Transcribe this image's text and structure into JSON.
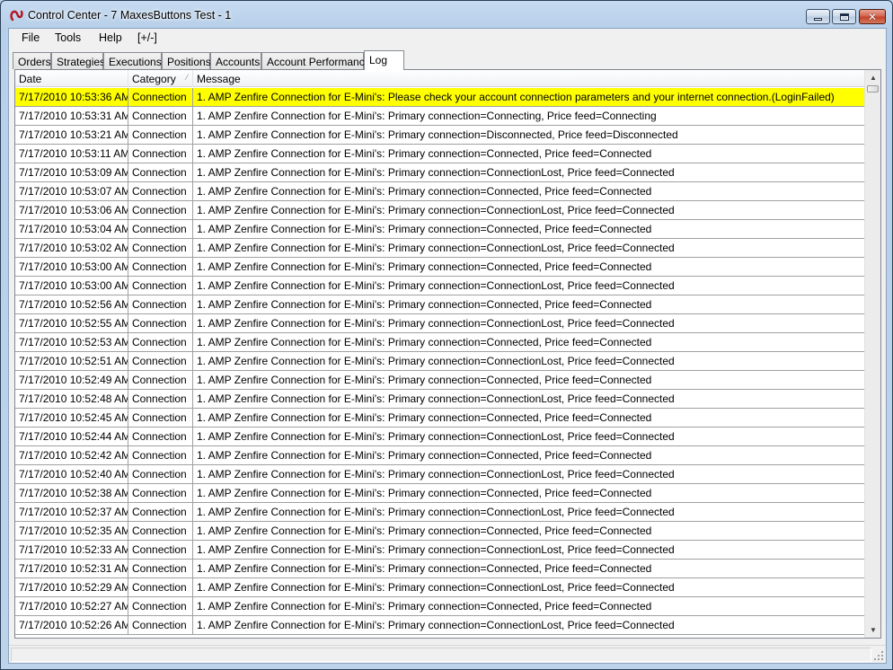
{
  "window": {
    "title": "Control Center - 7 MaxesButtons Test - 1",
    "app_icon": "ninja-logo-icon"
  },
  "menu": {
    "items": [
      {
        "label": "File"
      },
      {
        "label": "Tools"
      },
      {
        "label": "Help"
      },
      {
        "label": "[+/-]"
      }
    ]
  },
  "tabs": [
    {
      "label": "Orders"
    },
    {
      "label": "Strategies"
    },
    {
      "label": "Executions"
    },
    {
      "label": "Positions"
    },
    {
      "label": "Accounts"
    },
    {
      "label": "Account Performance"
    },
    {
      "label": "Log",
      "active": true
    }
  ],
  "log": {
    "columns": {
      "date": "Date",
      "category": "Category",
      "message": "Message"
    },
    "highlight_color": "#ffff00",
    "rows": [
      {
        "date": "7/17/2010 10:53:36 AM",
        "category": "Connection",
        "message": "1. AMP Zenfire Connection for E-Mini's: Please check your account connection parameters and your internet connection.(LoginFailed)",
        "highlight": true
      },
      {
        "date": "7/17/2010 10:53:31 AM",
        "category": "Connection",
        "message": "1. AMP Zenfire Connection for E-Mini's: Primary connection=Connecting, Price feed=Connecting"
      },
      {
        "date": "7/17/2010 10:53:21 AM",
        "category": "Connection",
        "message": "1. AMP Zenfire Connection for E-Mini's: Primary connection=Disconnected, Price feed=Disconnected"
      },
      {
        "date": "7/17/2010 10:53:11 AM",
        "category": "Connection",
        "message": "1. AMP Zenfire Connection for E-Mini's: Primary connection=Connected, Price feed=Connected"
      },
      {
        "date": "7/17/2010 10:53:09 AM",
        "category": "Connection",
        "message": "1. AMP Zenfire Connection for E-Mini's: Primary connection=ConnectionLost, Price feed=Connected"
      },
      {
        "date": "7/17/2010 10:53:07 AM",
        "category": "Connection",
        "message": "1. AMP Zenfire Connection for E-Mini's: Primary connection=Connected, Price feed=Connected"
      },
      {
        "date": "7/17/2010 10:53:06 AM",
        "category": "Connection",
        "message": "1. AMP Zenfire Connection for E-Mini's: Primary connection=ConnectionLost, Price feed=Connected"
      },
      {
        "date": "7/17/2010 10:53:04 AM",
        "category": "Connection",
        "message": "1. AMP Zenfire Connection for E-Mini's: Primary connection=Connected, Price feed=Connected"
      },
      {
        "date": "7/17/2010 10:53:02 AM",
        "category": "Connection",
        "message": "1. AMP Zenfire Connection for E-Mini's: Primary connection=ConnectionLost, Price feed=Connected"
      },
      {
        "date": "7/17/2010 10:53:00 AM",
        "category": "Connection",
        "message": "1. AMP Zenfire Connection for E-Mini's: Primary connection=Connected, Price feed=Connected"
      },
      {
        "date": "7/17/2010 10:53:00 AM",
        "category": "Connection",
        "message": "1. AMP Zenfire Connection for E-Mini's: Primary connection=ConnectionLost, Price feed=Connected"
      },
      {
        "date": "7/17/2010 10:52:56 AM",
        "category": "Connection",
        "message": "1. AMP Zenfire Connection for E-Mini's: Primary connection=Connected, Price feed=Connected"
      },
      {
        "date": "7/17/2010 10:52:55 AM",
        "category": "Connection",
        "message": "1. AMP Zenfire Connection for E-Mini's: Primary connection=ConnectionLost, Price feed=Connected"
      },
      {
        "date": "7/17/2010 10:52:53 AM",
        "category": "Connection",
        "message": "1. AMP Zenfire Connection for E-Mini's: Primary connection=Connected, Price feed=Connected"
      },
      {
        "date": "7/17/2010 10:52:51 AM",
        "category": "Connection",
        "message": "1. AMP Zenfire Connection for E-Mini's: Primary connection=ConnectionLost, Price feed=Connected"
      },
      {
        "date": "7/17/2010 10:52:49 AM",
        "category": "Connection",
        "message": "1. AMP Zenfire Connection for E-Mini's: Primary connection=Connected, Price feed=Connected"
      },
      {
        "date": "7/17/2010 10:52:48 AM",
        "category": "Connection",
        "message": "1. AMP Zenfire Connection for E-Mini's: Primary connection=ConnectionLost, Price feed=Connected"
      },
      {
        "date": "7/17/2010 10:52:45 AM",
        "category": "Connection",
        "message": "1. AMP Zenfire Connection for E-Mini's: Primary connection=Connected, Price feed=Connected"
      },
      {
        "date": "7/17/2010 10:52:44 AM",
        "category": "Connection",
        "message": "1. AMP Zenfire Connection for E-Mini's: Primary connection=ConnectionLost, Price feed=Connected"
      },
      {
        "date": "7/17/2010 10:52:42 AM",
        "category": "Connection",
        "message": "1. AMP Zenfire Connection for E-Mini's: Primary connection=Connected, Price feed=Connected"
      },
      {
        "date": "7/17/2010 10:52:40 AM",
        "category": "Connection",
        "message": "1. AMP Zenfire Connection for E-Mini's: Primary connection=ConnectionLost, Price feed=Connected"
      },
      {
        "date": "7/17/2010 10:52:38 AM",
        "category": "Connection",
        "message": "1. AMP Zenfire Connection for E-Mini's: Primary connection=Connected, Price feed=Connected"
      },
      {
        "date": "7/17/2010 10:52:37 AM",
        "category": "Connection",
        "message": "1. AMP Zenfire Connection for E-Mini's: Primary connection=ConnectionLost, Price feed=Connected"
      },
      {
        "date": "7/17/2010 10:52:35 AM",
        "category": "Connection",
        "message": "1. AMP Zenfire Connection for E-Mini's: Primary connection=Connected, Price feed=Connected"
      },
      {
        "date": "7/17/2010 10:52:33 AM",
        "category": "Connection",
        "message": "1. AMP Zenfire Connection for E-Mini's: Primary connection=ConnectionLost, Price feed=Connected"
      },
      {
        "date": "7/17/2010 10:52:31 AM",
        "category": "Connection",
        "message": "1. AMP Zenfire Connection for E-Mini's: Primary connection=Connected, Price feed=Connected"
      },
      {
        "date": "7/17/2010 10:52:29 AM",
        "category": "Connection",
        "message": "1. AMP Zenfire Connection for E-Mini's: Primary connection=ConnectionLost, Price feed=Connected"
      },
      {
        "date": "7/17/2010 10:52:27 AM",
        "category": "Connection",
        "message": "1. AMP Zenfire Connection for E-Mini's: Primary connection=Connected, Price feed=Connected"
      },
      {
        "date": "7/17/2010 10:52:26 AM",
        "category": "Connection",
        "message": "1. AMP Zenfire Connection for E-Mini's: Primary connection=ConnectionLost, Price feed=Connected"
      }
    ]
  }
}
